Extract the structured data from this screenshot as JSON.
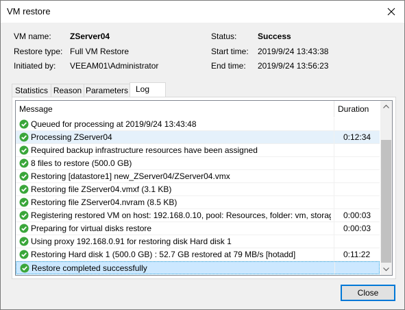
{
  "window": {
    "title": "VM restore"
  },
  "info": {
    "vm_name_label": "VM name:",
    "vm_name": "ZServer04",
    "restore_type_label": "Restore type:",
    "restore_type": "Full VM Restore",
    "initiated_by_label": "Initiated by:",
    "initiated_by": "VEEAM01\\Administrator",
    "status_label": "Status:",
    "status": "Success",
    "start_time_label": "Start time:",
    "start_time": "2019/9/24 13:43:38",
    "end_time_label": "End time:",
    "end_time": "2019/9/24 13:56:23"
  },
  "tabs": [
    "Statistics",
    "Reason",
    "Parameters",
    "Log"
  ],
  "active_tab": "Log",
  "log": {
    "col_message": "Message",
    "col_duration": "Duration",
    "rows": [
      {
        "message": "Queued for processing at 2019/9/24 13:43:48",
        "duration": ""
      },
      {
        "message": "Processing ZServer04",
        "duration": "0:12:34"
      },
      {
        "message": "Required backup infrastructure resources have been assigned",
        "duration": ""
      },
      {
        "message": "8 files to restore (500.0 GB)",
        "duration": ""
      },
      {
        "message": "Restoring [datastore1] new_ZServer04/ZServer04.vmx",
        "duration": ""
      },
      {
        "message": "Restoring file ZServer04.vmxf (3.1 KB)",
        "duration": ""
      },
      {
        "message": "Restoring file ZServer04.nvram (8.5 KB)",
        "duration": ""
      },
      {
        "message": "Registering restored VM on host: 192.168.0.10, pool: Resources, folder: vm, storag...",
        "duration": "0:00:03"
      },
      {
        "message": "Preparing for virtual disks restore",
        "duration": "0:00:03"
      },
      {
        "message": "Using proxy 192.168.0.91 for restoring disk Hard disk 1",
        "duration": ""
      },
      {
        "message": "Restoring Hard disk 1 (500.0 GB) : 52.7 GB restored at 79 MB/s  [hotadd]",
        "duration": "0:11:22"
      },
      {
        "message": "Restore completed successfully",
        "duration": ""
      }
    ],
    "status_icon": "success-check-icon"
  },
  "buttons": {
    "close": "Close"
  },
  "colors": {
    "success_green": "#3aa63a",
    "selection": "#cce8ff",
    "accent": "#0078d7"
  }
}
